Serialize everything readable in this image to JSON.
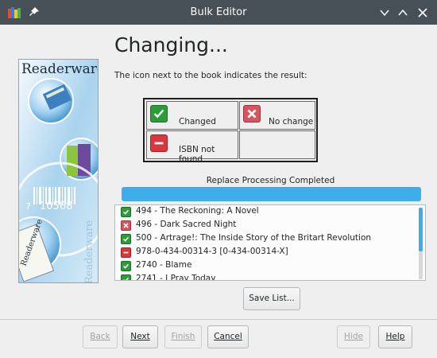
{
  "window": {
    "title": "Bulk Editor",
    "colors": {
      "titlebar": "#475057",
      "accent": "#3daee9"
    }
  },
  "side_image": {
    "brand": "Readerware",
    "number": "10568",
    "digit_left": "7",
    "spine_text": "Readerware"
  },
  "main": {
    "heading": "Changing...",
    "subtext": "The icon next to the book indicates the result:"
  },
  "legend": {
    "changed": "Changed",
    "no_change": "No change",
    "isbn_not_found": "ISBN not found"
  },
  "status": {
    "label": "Replace Processing Completed",
    "progress": 1.0
  },
  "results": [
    {
      "status": "changed",
      "text": "494 - The Reckoning: A Novel"
    },
    {
      "status": "no_change",
      "text": "496 - Dark Sacred Night"
    },
    {
      "status": "changed",
      "text": "500 - Artrage!: The Inside Story of the Britart Revolution"
    },
    {
      "status": "not_found",
      "text": "978-0-434-00314-3 [0-434-00314-X]"
    },
    {
      "status": "changed",
      "text": "2740 - Blame"
    },
    {
      "status": "changed",
      "text": "2741 - I Pray Today"
    }
  ],
  "buttons": {
    "save_list": "Save List...",
    "back": "Back",
    "next": "Next",
    "finish": "Finish",
    "cancel": "Cancel",
    "hide": "Hide",
    "help": "Help"
  }
}
